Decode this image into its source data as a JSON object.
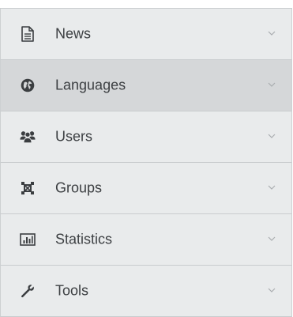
{
  "menu": {
    "items": [
      {
        "label": "News",
        "icon": "document-icon",
        "active": false
      },
      {
        "label": "Languages",
        "icon": "globe-icon",
        "active": true
      },
      {
        "label": "Users",
        "icon": "users-icon",
        "active": false
      },
      {
        "label": "Groups",
        "icon": "groups-icon",
        "active": false
      },
      {
        "label": "Statistics",
        "icon": "bar-chart-icon",
        "active": false
      },
      {
        "label": "Tools",
        "icon": "wrench-icon",
        "active": false
      }
    ]
  },
  "colors": {
    "item_bg": "#e9ebec",
    "active_bg": "#d5d7d9",
    "text": "#3c3f42",
    "icon": "#3b3e41",
    "chevron": "#a9adb0",
    "border": "#c9ccce"
  }
}
